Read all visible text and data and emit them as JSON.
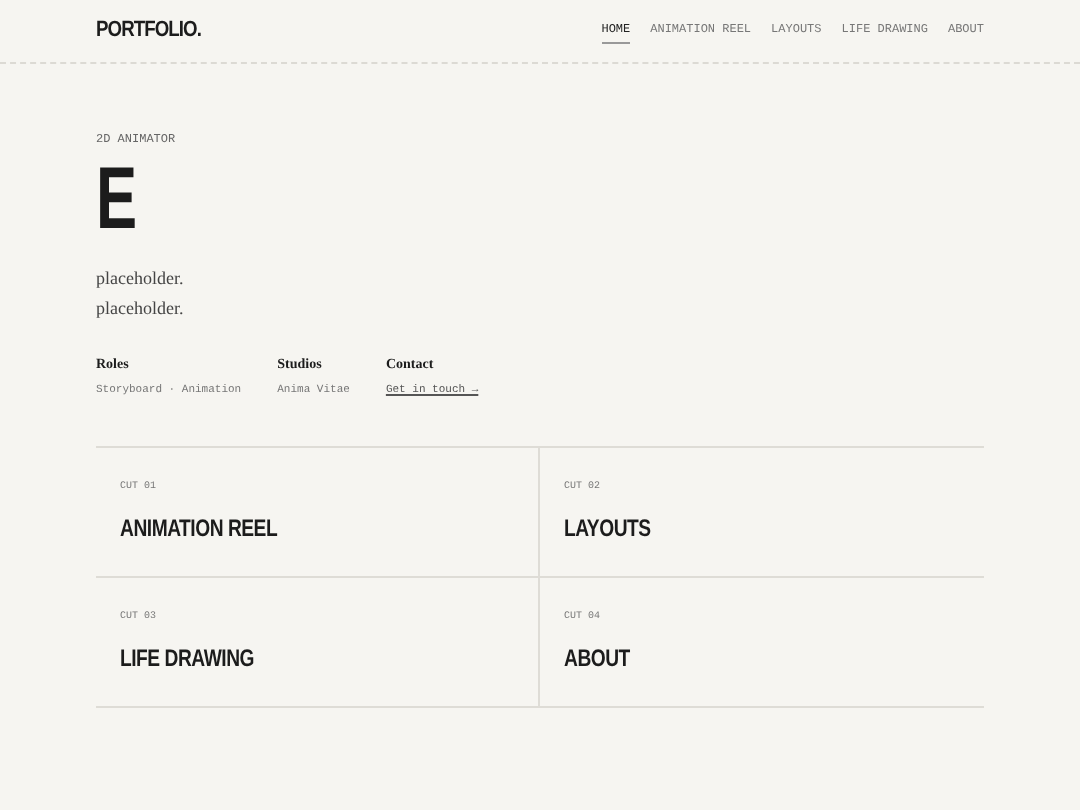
{
  "logo": "PORTFOLIO.",
  "nav": [
    {
      "label": "HOME",
      "selected": true
    },
    {
      "label": "ANIMATION REEL",
      "selected": false
    },
    {
      "label": "LAYOUTS",
      "selected": false
    },
    {
      "label": "LIFE DRAWING",
      "selected": false
    },
    {
      "label": "ABOUT",
      "selected": false
    }
  ],
  "hero": {
    "eyebrow": "2D ANIMATOR",
    "title": "E",
    "lines": [
      "placeholder.",
      "placeholder."
    ]
  },
  "meta": [
    {
      "label": "Roles",
      "value": "Storyboard · Animation",
      "kind": "text"
    },
    {
      "label": "Studios",
      "value": "Anima Vitae",
      "kind": "text"
    },
    {
      "label": "Contact",
      "value": "Get in touch →",
      "kind": "link"
    }
  ],
  "cuts": [
    {
      "number": "CUT 01",
      "title": "ANIMATION REEL"
    },
    {
      "number": "CUT 02",
      "title": "LAYOUTS"
    },
    {
      "number": "CUT 03",
      "title": "LIFE DRAWING"
    },
    {
      "number": "CUT 04",
      "title": "ABOUT"
    }
  ]
}
